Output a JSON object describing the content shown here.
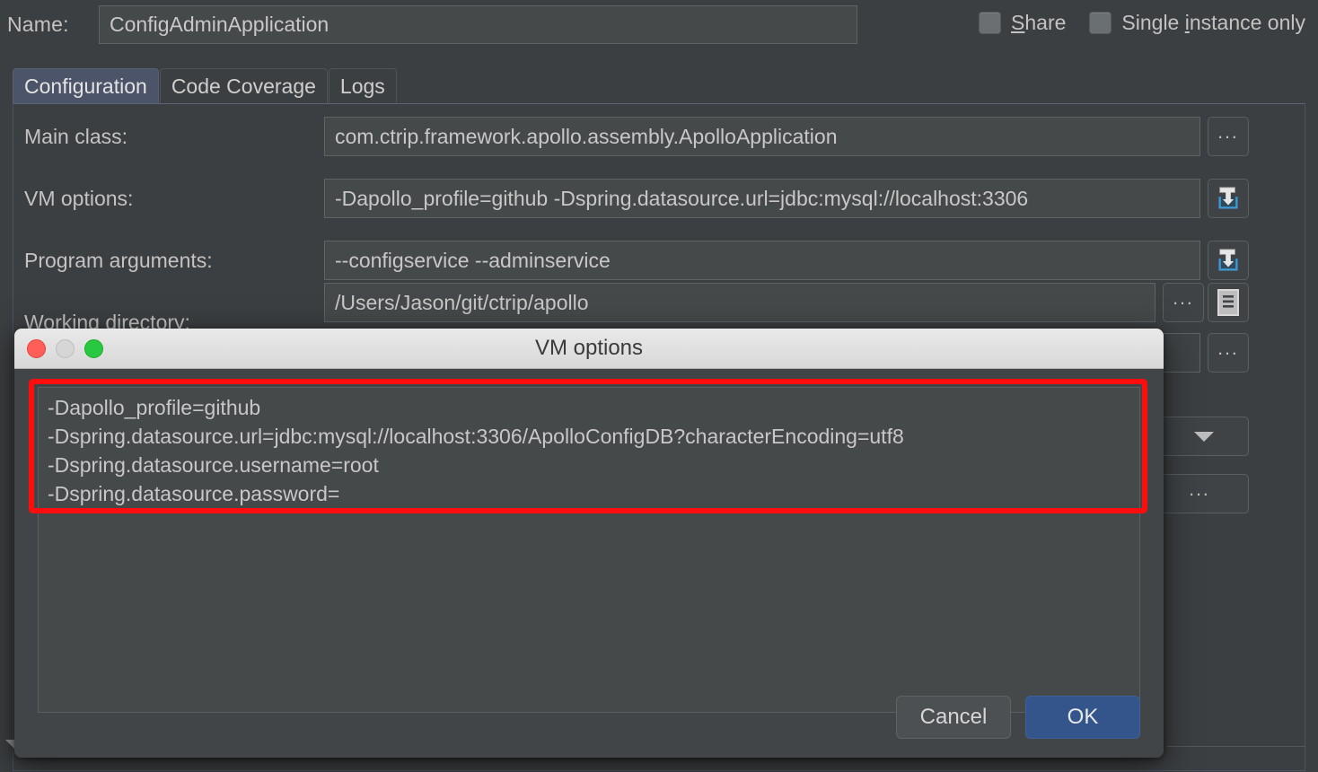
{
  "window": {
    "name_label": "Name:",
    "name_value": "ConfigAdminApplication",
    "checkboxes": [
      {
        "label_before": "",
        "mnemonic": "S",
        "label_after": "hare",
        "name": "share",
        "checked": false
      },
      {
        "label_before": "Single ",
        "mnemonic": "i",
        "label_after": "nstance only",
        "name": "single-instance-only",
        "checked": false
      }
    ],
    "tabs": [
      {
        "label": "Configuration",
        "active": true
      },
      {
        "label": "Code Coverage",
        "active": false
      },
      {
        "label": "Logs",
        "active": false
      }
    ],
    "fields": [
      {
        "label": "Main class:",
        "value": "com.ctrip.framework.apollo.assembly.ApolloApplication"
      },
      {
        "label": "VM options:",
        "value": "-Dapollo_profile=github -Dspring.datasource.url=jdbc:mysql://localhost:3306"
      },
      {
        "label": "Program arguments:",
        "value": "--configservice --adminservice"
      },
      {
        "label": "Working directory:",
        "value": "/Users/Jason/git/ctrip/apollo"
      }
    ],
    "browse_label": "...",
    "icons": {
      "macro": "insert-macro-icon",
      "document": "document-icon",
      "caret": "chevron-down-icon"
    }
  },
  "dialog": {
    "title": "VM options",
    "lines": [
      "-Dapollo_profile=github",
      "-Dspring.datasource.url=jdbc:mysql://localhost:3306/ApolloConfigDB?characterEncoding=utf8",
      "-Dspring.datasource.username=root",
      "-Dspring.datasource.password="
    ],
    "cancel_label": "Cancel",
    "ok_label": "OK",
    "annotation_color": "#fd0d0d"
  }
}
